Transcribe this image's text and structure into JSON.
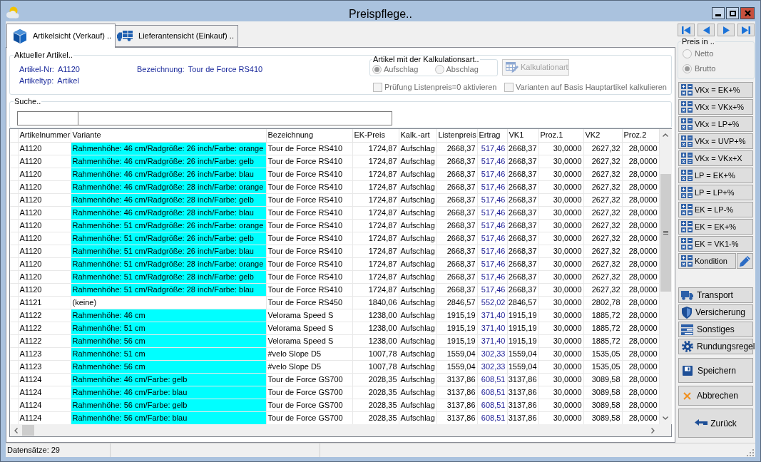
{
  "window": {
    "title": "Preispflege.."
  },
  "tabs": [
    {
      "label": "Artikelsicht (Verkauf) ..",
      "kind": "article",
      "selected": true
    },
    {
      "label": "Lieferantensicht (Einkauf) ..",
      "kind": "supplier",
      "selected": false
    }
  ],
  "current_article": {
    "title": "Aktueller Artikel..",
    "fields": [
      {
        "label": "Artikel-Nr:",
        "value": "A1120"
      },
      {
        "label": "Artikeltyp:",
        "value": "Artikel"
      },
      {
        "label": "Bezeichnung:",
        "value": "Tour de Force RS410"
      }
    ],
    "calculation_type": {
      "title": "Artikel mit der Kalkulationsart..",
      "disabled": true,
      "options": [
        {
          "label": "Aufschlag",
          "selected": true
        },
        {
          "label": "Abschlag",
          "selected": false
        }
      ]
    },
    "calculation_button": {
      "label": "Kalkulationart",
      "disabled": true
    },
    "checkboxes": [
      {
        "label": "Prüfung Listenpreis=0 aktivieren",
        "checked": false,
        "disabled": true
      },
      {
        "label": "Varianten auf Basis Hauptartikel kalkulieren",
        "checked": false,
        "disabled": true
      }
    ]
  },
  "search": {
    "title": "Suche.."
  },
  "table": {
    "columns": [
      {
        "label": "Artikelnummer",
        "kind": "text"
      },
      {
        "label": "Variante",
        "kind": "variant"
      },
      {
        "label": "Bezeichnung",
        "kind": "text"
      },
      {
        "label": "EK-Preis",
        "kind": "number"
      },
      {
        "label": "Kalk.-art",
        "kind": "text"
      },
      {
        "label": "Listenpreis",
        "kind": "number"
      },
      {
        "label": "Ertrag",
        "kind": "profit"
      },
      {
        "label": "VK1",
        "kind": "number"
      },
      {
        "label": "Proz.1",
        "kind": "number"
      },
      {
        "label": "VK2",
        "kind": "number"
      },
      {
        "label": "Proz.2",
        "kind": "number"
      }
    ],
    "rows": [
      {
        "cells": [
          "A1120",
          "Rahmenhöhe: 46 cm/Radgröße: 26 inch/Farbe: orange",
          "Tour de Force RS410",
          "1724,87",
          "Aufschlag",
          "2668,37",
          "517,46",
          "2668,37",
          "30,0000",
          "2627,32",
          "28,0000"
        ],
        "variant_highlighted": true
      },
      {
        "cells": [
          "A1120",
          "Rahmenhöhe: 46 cm/Radgröße: 26 inch/Farbe: gelb",
          "Tour de Force RS410",
          "1724,87",
          "Aufschlag",
          "2668,37",
          "517,46",
          "2668,37",
          "30,0000",
          "2627,32",
          "28,0000"
        ],
        "variant_highlighted": true
      },
      {
        "cells": [
          "A1120",
          "Rahmenhöhe: 46 cm/Radgröße: 26 inch/Farbe: blau",
          "Tour de Force RS410",
          "1724,87",
          "Aufschlag",
          "2668,37",
          "517,46",
          "2668,37",
          "30,0000",
          "2627,32",
          "28,0000"
        ],
        "variant_highlighted": true
      },
      {
        "cells": [
          "A1120",
          "Rahmenhöhe: 46 cm/Radgröße: 28 inch/Farbe: orange",
          "Tour de Force RS410",
          "1724,87",
          "Aufschlag",
          "2668,37",
          "517,46",
          "2668,37",
          "30,0000",
          "2627,32",
          "28,0000"
        ],
        "variant_highlighted": true
      },
      {
        "cells": [
          "A1120",
          "Rahmenhöhe: 46 cm/Radgröße: 28 inch/Farbe: gelb",
          "Tour de Force RS410",
          "1724,87",
          "Aufschlag",
          "2668,37",
          "517,46",
          "2668,37",
          "30,0000",
          "2627,32",
          "28,0000"
        ],
        "variant_highlighted": true
      },
      {
        "cells": [
          "A1120",
          "Rahmenhöhe: 46 cm/Radgröße: 28 inch/Farbe: blau",
          "Tour de Force RS410",
          "1724,87",
          "Aufschlag",
          "2668,37",
          "517,46",
          "2668,37",
          "30,0000",
          "2627,32",
          "28,0000"
        ],
        "variant_highlighted": true
      },
      {
        "cells": [
          "A1120",
          "Rahmenhöhe: 51 cm/Radgröße: 26 inch/Farbe: orange",
          "Tour de Force RS410",
          "1724,87",
          "Aufschlag",
          "2668,37",
          "517,46",
          "2668,37",
          "30,0000",
          "2627,32",
          "28,0000"
        ],
        "variant_highlighted": true
      },
      {
        "cells": [
          "A1120",
          "Rahmenhöhe: 51 cm/Radgröße: 26 inch/Farbe: gelb",
          "Tour de Force RS410",
          "1724,87",
          "Aufschlag",
          "2668,37",
          "517,46",
          "2668,37",
          "30,0000",
          "2627,32",
          "28,0000"
        ],
        "variant_highlighted": true
      },
      {
        "cells": [
          "A1120",
          "Rahmenhöhe: 51 cm/Radgröße: 26 inch/Farbe: blau",
          "Tour de Force RS410",
          "1724,87",
          "Aufschlag",
          "2668,37",
          "517,46",
          "2668,37",
          "30,0000",
          "2627,32",
          "28,0000"
        ],
        "variant_highlighted": true
      },
      {
        "cells": [
          "A1120",
          "Rahmenhöhe: 51 cm/Radgröße: 28 inch/Farbe: orange",
          "Tour de Force RS410",
          "1724,87",
          "Aufschlag",
          "2668,37",
          "517,46",
          "2668,37",
          "30,0000",
          "2627,32",
          "28,0000"
        ],
        "variant_highlighted": true
      },
      {
        "cells": [
          "A1120",
          "Rahmenhöhe: 51 cm/Radgröße: 28 inch/Farbe: gelb",
          "Tour de Force RS410",
          "1724,87",
          "Aufschlag",
          "2668,37",
          "517,46",
          "2668,37",
          "30,0000",
          "2627,32",
          "28,0000"
        ],
        "variant_highlighted": true
      },
      {
        "cells": [
          "A1120",
          "Rahmenhöhe: 51 cm/Radgröße: 28 inch/Farbe: blau",
          "Tour de Force RS410",
          "1724,87",
          "Aufschlag",
          "2668,37",
          "517,46",
          "2668,37",
          "30,0000",
          "2627,32",
          "28,0000"
        ],
        "variant_highlighted": true
      },
      {
        "cells": [
          "A1121",
          "(keine)",
          "Tour de Force RS450",
          "1840,06",
          "Aufschlag",
          "2846,57",
          "552,02",
          "2846,57",
          "30,0000",
          "2802,78",
          "28,0000"
        ],
        "variant_highlighted": false
      },
      {
        "cells": [
          "A1122",
          "Rahmenhöhe: 46 cm",
          "Velorama Speed S",
          "1238,00",
          "Aufschlag",
          "1915,19",
          "371,40",
          "1915,19",
          "30,0000",
          "1885,72",
          "28,0000"
        ],
        "variant_highlighted": true
      },
      {
        "cells": [
          "A1122",
          "Rahmenhöhe: 51 cm",
          "Velorama Speed S",
          "1238,00",
          "Aufschlag",
          "1915,19",
          "371,40",
          "1915,19",
          "30,0000",
          "1885,72",
          "28,0000"
        ],
        "variant_highlighted": true
      },
      {
        "cells": [
          "A1122",
          "Rahmenhöhe: 56 cm",
          "Velorama Speed S",
          "1238,00",
          "Aufschlag",
          "1915,19",
          "371,40",
          "1915,19",
          "30,0000",
          "1885,72",
          "28,0000"
        ],
        "variant_highlighted": true
      },
      {
        "cells": [
          "A1123",
          "Rahmenhöhe: 51 cm",
          "#velo Slope D5",
          "1007,78",
          "Aufschlag",
          "1559,04",
          "302,33",
          "1559,04",
          "30,0000",
          "1535,05",
          "28,0000"
        ],
        "variant_highlighted": true
      },
      {
        "cells": [
          "A1123",
          "Rahmenhöhe: 56 cm",
          "#velo Slope D5",
          "1007,78",
          "Aufschlag",
          "1559,04",
          "302,33",
          "1559,04",
          "30,0000",
          "1535,05",
          "28,0000"
        ],
        "variant_highlighted": true
      },
      {
        "cells": [
          "A1124",
          "Rahmenhöhe: 46 cm/Farbe: gelb",
          "Tour de Force GS700",
          "2028,35",
          "Aufschlag",
          "3137,86",
          "608,51",
          "3137,86",
          "30,0000",
          "3089,58",
          "28,0000"
        ],
        "variant_highlighted": true
      },
      {
        "cells": [
          "A1124",
          "Rahmenhöhe: 46 cm/Farbe: blau",
          "Tour de Force GS700",
          "2028,35",
          "Aufschlag",
          "3137,86",
          "608,51",
          "3137,86",
          "30,0000",
          "3089,58",
          "28,0000"
        ],
        "variant_highlighted": true
      },
      {
        "cells": [
          "A1124",
          "Rahmenhöhe: 56 cm/Farbe: gelb",
          "Tour de Force GS700",
          "2028,35",
          "Aufschlag",
          "3137,86",
          "608,51",
          "3137,86",
          "30,0000",
          "3089,58",
          "28,0000"
        ],
        "variant_highlighted": true
      },
      {
        "cells": [
          "A1124",
          "Rahmenhöhe: 56 cm/Farbe: blau",
          "Tour de Force GS700",
          "2028,35",
          "Aufschlag",
          "3137,86",
          "608,51",
          "3137,86",
          "30,0000",
          "3089,58",
          "28,0000"
        ],
        "variant_highlighted": true
      }
    ]
  },
  "status_bar": {
    "record_count": "Datensätze: 29"
  },
  "price_in": {
    "title": "Preis in ..",
    "disabled": true,
    "options": [
      {
        "label": "Netto",
        "selected": false
      },
      {
        "label": "Brutto",
        "selected": true
      }
    ]
  },
  "calculation_buttons": [
    "VKx = EK+%",
    "VKx = VKx+%",
    "VKx = LP+%",
    "VKx = UVP+%",
    "VKx = VKx+X",
    "LP = EK+%",
    "LP = LP+%",
    "EK = LP-%",
    "EK = EK+%",
    "EK = VK1-%"
  ],
  "condition_button": {
    "label": "Kondition"
  },
  "action_buttons": [
    {
      "label": "Transport",
      "kind": "truck"
    },
    {
      "label": "Versicherung",
      "kind": "shield"
    },
    {
      "label": "Sonstiges",
      "kind": "list"
    },
    {
      "label": "Rundungsregel",
      "kind": "gear"
    },
    {
      "label": "Speichern",
      "kind": "save"
    },
    {
      "label": "Abbrechen",
      "kind": "cancel"
    },
    {
      "label": "Zurück",
      "kind": "back"
    }
  ]
}
